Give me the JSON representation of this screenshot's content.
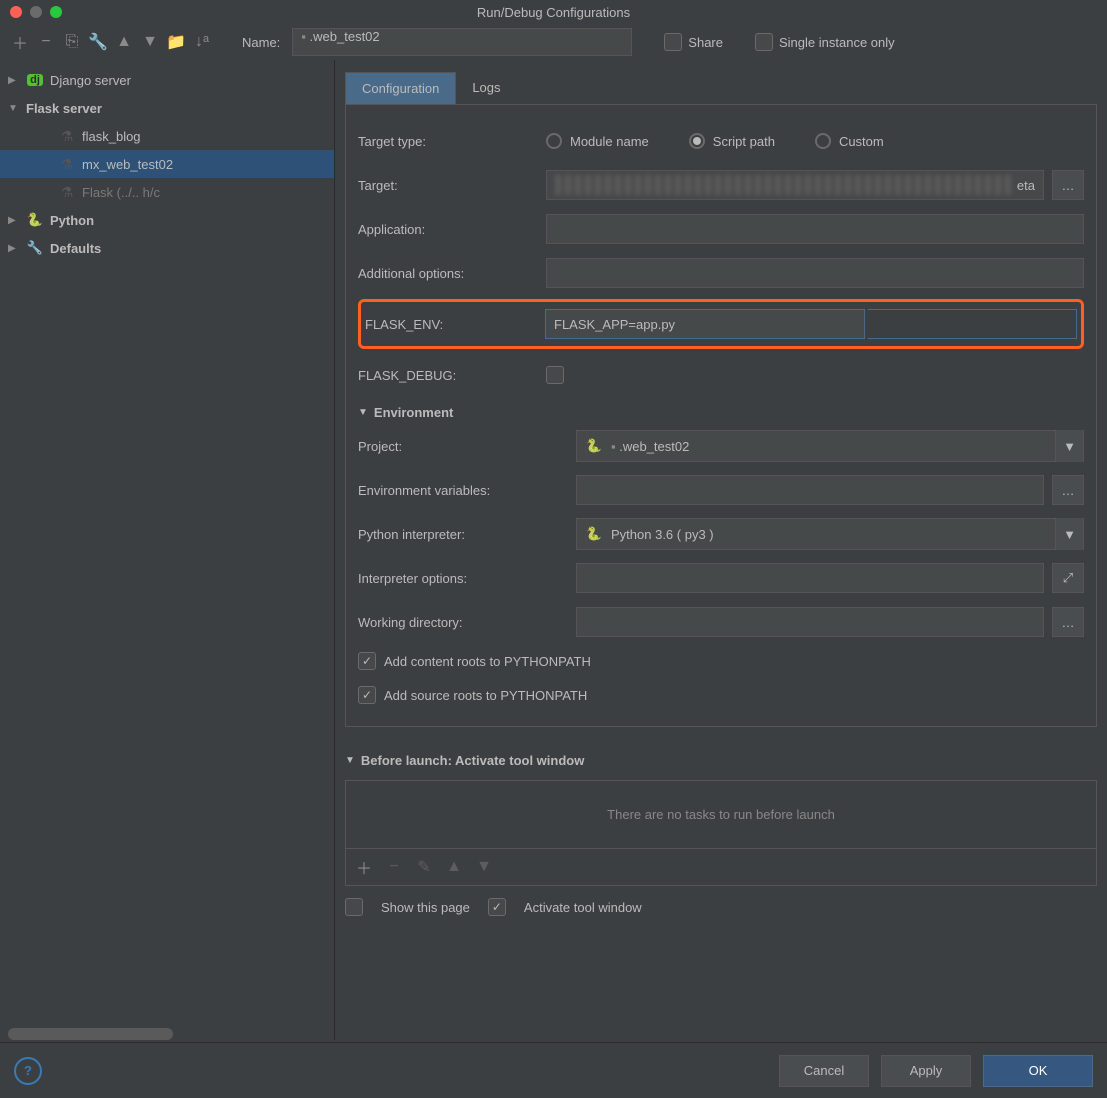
{
  "window": {
    "title": "Run/Debug Configurations"
  },
  "header": {
    "name_label": "Name:",
    "name_value": ".web_test02",
    "share_label": "Share",
    "single_instance_label": "Single instance only"
  },
  "sidebar": {
    "items": [
      {
        "label": "Django server",
        "type": "django",
        "expanded": true,
        "depth": 0
      },
      {
        "label": "Flask server",
        "type": "group",
        "expanded": true,
        "depth": 0
      },
      {
        "label": "flask_blog",
        "type": "flask",
        "depth": 2
      },
      {
        "label": "mx_web_test02",
        "type": "flask",
        "depth": 2,
        "selected": true
      },
      {
        "label": "Flask (../..      h/c",
        "type": "flask",
        "depth": 2,
        "dim": true
      },
      {
        "label": "Python",
        "type": "python",
        "expanded": false,
        "depth": 0
      },
      {
        "label": "Defaults",
        "type": "defaults",
        "expanded": false,
        "depth": 0
      }
    ]
  },
  "tabs": {
    "configuration": "Configuration",
    "logs": "Logs"
  },
  "config": {
    "target_type_label": "Target type:",
    "radios": {
      "module": "Module name",
      "script": "Script path",
      "custom": "Custom",
      "selected": "script"
    },
    "target_label": "Target:",
    "target_suffix": "eta",
    "application_label": "Application:",
    "additional_options_label": "Additional options:",
    "flask_env_label": "FLASK_ENV:",
    "flask_env_value": "FLASK_APP=app.py",
    "flask_debug_label": "FLASK_DEBUG:",
    "environment_section": "Environment",
    "project_label": "Project:",
    "project_value": ".web_test02",
    "env_vars_label": "Environment variables:",
    "interpreter_label": "Python interpreter:",
    "interpreter_value": "Python 3.6 ( py3 )",
    "interp_options_label": "Interpreter options:",
    "workdir_label": "Working directory:",
    "content_roots_label": "Add content roots to PYTHONPATH",
    "source_roots_label": "Add source roots to PYTHONPATH",
    "before_launch_label": "Before launch: Activate tool window",
    "no_tasks_text": "There are no tasks to run before launch",
    "show_page_label": "Show this page",
    "activate_tw_label": "Activate tool window"
  },
  "footer": {
    "cancel": "Cancel",
    "apply": "Apply",
    "ok": "OK"
  }
}
